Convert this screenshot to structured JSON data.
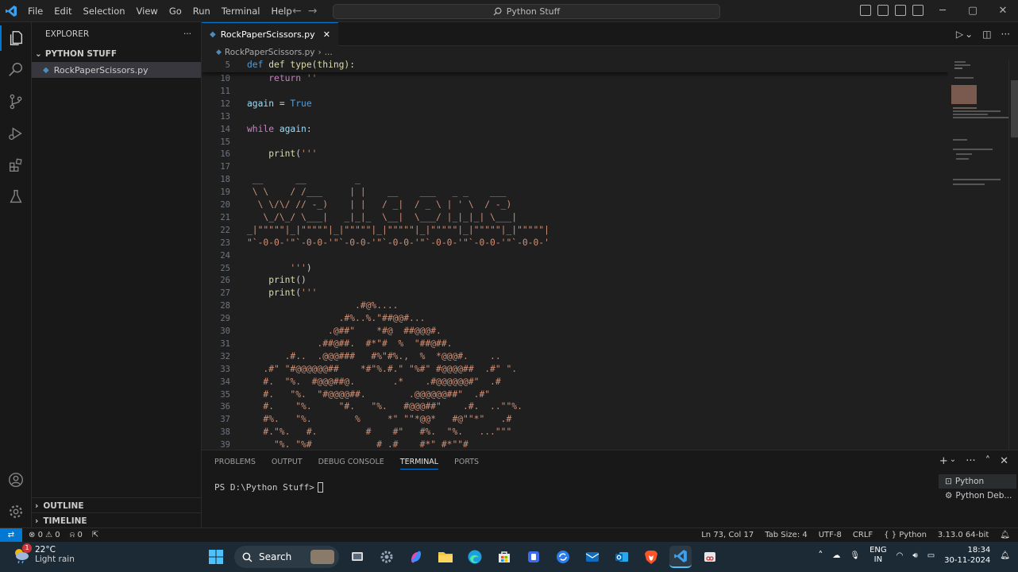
{
  "menu": [
    "File",
    "Edit",
    "Selection",
    "View",
    "Go",
    "Run",
    "Terminal",
    "Help"
  ],
  "command_center": "Python Stuff",
  "sidebar": {
    "title": "EXPLORER",
    "folder": "PYTHON STUFF",
    "file": "RockPaperScissors.py",
    "outline": "OUTLINE",
    "timeline": "TIMELINE"
  },
  "editor": {
    "tab": "RockPaperScissors.py",
    "breadcrumb_file": "RockPaperScissors.py",
    "breadcrumb_more": "...",
    "sticky_line": "5",
    "sticky_text": "def type(thing):",
    "lines": [
      {
        "n": "10",
        "t": "    return ''"
      },
      {
        "n": "11",
        "t": ""
      },
      {
        "n": "12",
        "t": "again = True"
      },
      {
        "n": "13",
        "t": ""
      },
      {
        "n": "14",
        "t": "while again:"
      },
      {
        "n": "15",
        "t": ""
      },
      {
        "n": "16",
        "t": "    print('''"
      },
      {
        "n": "17",
        "t": ""
      },
      {
        "n": "18",
        "t": " __      __         _"
      },
      {
        "n": "19",
        "t": " \\ \\    / /___     | |    __    ___   _ _    ___"
      },
      {
        "n": "20",
        "t": "  \\ \\/\\/ // -_)    | |   / _|  / _ \\ | ' \\  / -_)"
      },
      {
        "n": "21",
        "t": "   \\_/\\_/ \\___|   _|_|_  \\__|  \\___/ |_|_|_| \\___|"
      },
      {
        "n": "22",
        "t": "_|\"\"\"\"\"|_|\"\"\"\"\"|_|\"\"\"\"\"|_|\"\"\"\"\"|_|\"\"\"\"\"|_|\"\"\"\"\"|_|\"\"\"\"\"|"
      },
      {
        "n": "23",
        "t": "\"`-0-0-'\"`-0-0-'\"`-0-0-'\"`-0-0-'\"`-0-0-'\"`-0-0-'\"`-0-0-'"
      },
      {
        "n": "24",
        "t": ""
      },
      {
        "n": "25",
        "t": "        ''')"
      },
      {
        "n": "26",
        "t": "    print()"
      },
      {
        "n": "27",
        "t": "    print('''"
      },
      {
        "n": "28",
        "t": "                    .#@%...."
      },
      {
        "n": "29",
        "t": "                 .#%..%.\"##@@#..."
      },
      {
        "n": "30",
        "t": "               .@##\"    *#@  ##@@@#."
      },
      {
        "n": "31",
        "t": "             .##@##.  #*\"#  %  \"##@##."
      },
      {
        "n": "32",
        "t": "       .#..  .@@@###   #%\"#%.,  %  *@@@#.    .."
      },
      {
        "n": "33",
        "t": "   .#\" \"#@@@@@@##    *#\"%.#.\" \"%#\" #@@@@##  .#\" \"."
      },
      {
        "n": "34",
        "t": "   #.  \"%.  #@@@##@.       .*    .#@@@@@@#\"  .#"
      },
      {
        "n": "35",
        "t": "   #.   \"%.  \"#@@@@##.        .@@@@@@##\"  .#\""
      },
      {
        "n": "36",
        "t": "   #.    \"%.     \"#.   \"%.   #@@@##\"    .#.  ..\"\"%."
      },
      {
        "n": "37",
        "t": "   #%.   \"%.        %     *\" \"\"*@@*   #@\"\"*\"   .#"
      },
      {
        "n": "38",
        "t": "   #.\"%.   #.         #    #\"   #%.  \"%.   ...\"\"\""
      },
      {
        "n": "39",
        "t": "     \"%. \"%#            # .#    #*\" #*\"\"#"
      }
    ]
  },
  "panel": {
    "tabs": [
      "PROBLEMS",
      "OUTPUT",
      "DEBUG CONSOLE",
      "TERMINAL",
      "PORTS"
    ],
    "active_tab": "TERMINAL",
    "prompt": "PS D:\\Python Stuff>",
    "terminals": [
      "Python",
      "Python Deb..."
    ]
  },
  "status": {
    "errors": "0",
    "warnings": "0",
    "ports": "0",
    "position": "Ln 73, Col 17",
    "tab_size": "Tab Size: 4",
    "encoding": "UTF-8",
    "eol": "CRLF",
    "language": "Python",
    "interpreter": "3.13.0 64-bit"
  },
  "taskbar": {
    "temp": "22°C",
    "weather": "Light rain",
    "weather_badge": "1",
    "search": "Search",
    "lang1": "ENG",
    "lang2": "IN",
    "time": "18:34",
    "date": "30-11-2024"
  },
  "colors": {
    "accent": "#0078d4",
    "ascii_art": "#ce9178"
  }
}
